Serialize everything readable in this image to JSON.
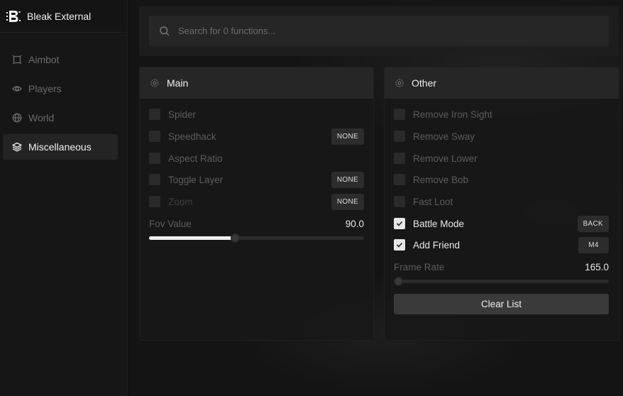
{
  "app": {
    "title": "Bleak External",
    "logo_icon": "bleak-logo-icon"
  },
  "sidebar": {
    "items": [
      {
        "label": "Aimbot",
        "icon": "crosshair-icon",
        "active": false
      },
      {
        "label": "Players",
        "icon": "eye-icon",
        "active": false
      },
      {
        "label": "World",
        "icon": "globe-icon",
        "active": false
      },
      {
        "label": "Miscellaneous",
        "icon": "layers-icon",
        "active": true
      }
    ]
  },
  "search": {
    "placeholder": "Search for 0 functions...",
    "value": ""
  },
  "main_panel": {
    "title": "Main",
    "toggles": [
      {
        "label": "Spider",
        "checked": false,
        "keybind": ""
      },
      {
        "label": "Speedhack",
        "checked": false,
        "keybind": "NONE"
      },
      {
        "label": "Aspect Ratio",
        "checked": false,
        "keybind": ""
      },
      {
        "label": "Toggle Layer",
        "checked": false,
        "keybind": "NONE"
      },
      {
        "label": "Zoom",
        "checked": false,
        "keybind": "NONE"
      }
    ],
    "slider": {
      "label": "Fov Value",
      "value_text": "90.0",
      "fraction": 0.4
    }
  },
  "other_panel": {
    "title": "Other",
    "toggles": [
      {
        "label": "Remove Iron Sight",
        "checked": false,
        "keybind": ""
      },
      {
        "label": "Remove Sway",
        "checked": false,
        "keybind": ""
      },
      {
        "label": "Remove Lower",
        "checked": false,
        "keybind": ""
      },
      {
        "label": "Remove Bob",
        "checked": false,
        "keybind": ""
      },
      {
        "label": "Fast Loot",
        "checked": false,
        "keybind": ""
      },
      {
        "label": "Battle Mode",
        "checked": true,
        "keybind": "BACK"
      },
      {
        "label": "Add Friend",
        "checked": true,
        "keybind": "M4"
      }
    ],
    "slider": {
      "label": "Frame Rate",
      "value_text": "165.0",
      "fraction": 0.0
    },
    "button_label": "Clear List"
  },
  "colors": {
    "accent": "#efefef",
    "background": "#141414",
    "panel_header": "#262626"
  }
}
